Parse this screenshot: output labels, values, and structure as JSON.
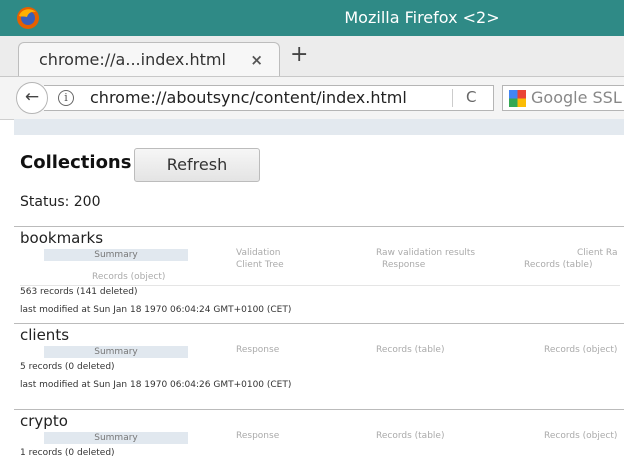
{
  "window": {
    "title": "Mozilla Firefox <2>"
  },
  "tab": {
    "label": "chrome://a...index.html",
    "close": "×",
    "new_tab": "+"
  },
  "navbar": {
    "back": "←",
    "info": "i",
    "url": "chrome://aboutsync/content/index.html",
    "reload": "C",
    "search_placeholder": "Google SSL"
  },
  "page": {
    "heading": "Collections",
    "refresh_label": "Refresh",
    "status": "Status: 200"
  },
  "collections": [
    {
      "name": "bookmarks",
      "tabs": [
        "Summary",
        "Validation",
        "Raw validation results",
        "Client Ra",
        "Client Tree",
        "Response",
        "Records (table)",
        "Records (object)"
      ],
      "lines": [
        "563 records (141 deleted)",
        "last modified at Sun Jan 18 1970 06:04:24 GMT+0100 (CET)"
      ]
    },
    {
      "name": "clients",
      "tabs": [
        "Summary",
        "Response",
        "Records (table)",
        "Records (object)"
      ],
      "lines": [
        "5 records (0 deleted)",
        "last modified at Sun Jan 18 1970 06:04:26 GMT+0100 (CET)"
      ]
    },
    {
      "name": "crypto",
      "tabs": [
        "Summary",
        "Response",
        "Records (table)",
        "Records (object)"
      ],
      "lines": [
        "1 records (0 deleted)"
      ]
    }
  ],
  "colors": {
    "titlebar": "#2f8a86",
    "summary_tab": "#e1e8ef"
  }
}
